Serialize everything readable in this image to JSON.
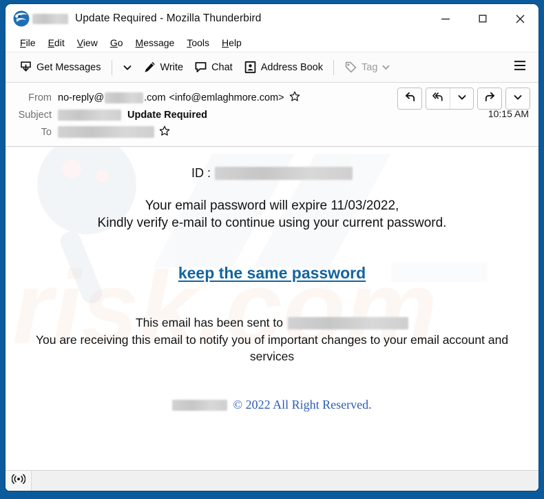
{
  "window": {
    "title": "Update Required - Mozilla Thunderbird",
    "logo_icon": "thunderbird-logo-icon",
    "redacted_label": "",
    "controls": {
      "minimize": "minimize-icon",
      "maximize": "maximize-icon",
      "close": "close-icon"
    }
  },
  "menubar": {
    "items": [
      {
        "label": "File",
        "accesskey": "F"
      },
      {
        "label": "Edit",
        "accesskey": "E"
      },
      {
        "label": "View",
        "accesskey": "V"
      },
      {
        "label": "Go",
        "accesskey": "G"
      },
      {
        "label": "Message",
        "accesskey": "M"
      },
      {
        "label": "Tools",
        "accesskey": "T"
      },
      {
        "label": "Help",
        "accesskey": "H"
      }
    ]
  },
  "toolbar": {
    "get_messages": "Get Messages",
    "get_messages_icon": "inbox-download-icon",
    "get_messages_dropdown_icon": "chevron-down-icon",
    "write": "Write",
    "write_icon": "pencil-icon",
    "chat": "Chat",
    "chat_icon": "speech-bubble-icon",
    "address_book": "Address Book",
    "address_book_icon": "address-book-icon",
    "tag": "Tag",
    "tag_icon": "tag-icon",
    "tag_dropdown_icon": "chevron-down-icon",
    "tag_disabled": true,
    "app_menu_icon": "hamburger-menu-icon"
  },
  "message": {
    "from_label": "From",
    "from_display_redacted": "",
    "from_prefix": "no-reply@",
    "from_suffix": ".com",
    "from_address": "<info@emlaghmore.com>",
    "subject_label": "Subject",
    "subject_redacted": "",
    "subject": "Update Required",
    "to_label": "To",
    "to_redacted": "",
    "time": "10:15 AM",
    "star_icon": "star-outline-icon",
    "actions": {
      "reply_icon": "reply-arrow-icon",
      "reply_all_icon": "reply-all-arrow-icon",
      "reply_all_dropdown_icon": "chevron-down-icon",
      "forward_icon": "forward-arrow-icon",
      "more_dropdown_icon": "chevron-down-icon"
    }
  },
  "body": {
    "id_label": "ID :",
    "id_value_redacted": "",
    "line1": "Your email password will expire 11/03/2022,",
    "line2": "Kindly verify e-mail to continue using your current password.",
    "cta_link": "keep the same password",
    "sent_to_text": "This email has been sent to",
    "sent_to_redacted": "",
    "notice": "You are receiving this email to notify you of important changes to your email account and services",
    "copyright_brand_redacted": "",
    "copyright": "© 2022 All Right Reserved.",
    "link_color": "#1364a0",
    "copyright_color": "#2c5cb5",
    "watermark_text": "PCrisk.com"
  },
  "statusbar": {
    "connection_icon": "broadcast-signal-icon",
    "text": ""
  }
}
